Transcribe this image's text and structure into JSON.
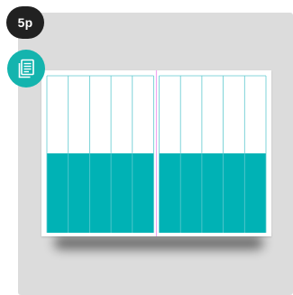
{
  "badges": {
    "page_count": "5p",
    "document_icon": "document-stack-icon"
  },
  "colors": {
    "background": "#ffffff",
    "panel": "#dcdcdc",
    "badge_dark": "#212121",
    "teal": "#00b2b5",
    "badge_teal": "#14b4ae",
    "guide_teal": "#5fc9cf",
    "spine_magenta": "#f0a6f2",
    "shadow": "#3a3a3a"
  },
  "layout_diagram": {
    "pages": 2,
    "columns_per_page": 5,
    "image_fill_fraction": 0.5
  }
}
